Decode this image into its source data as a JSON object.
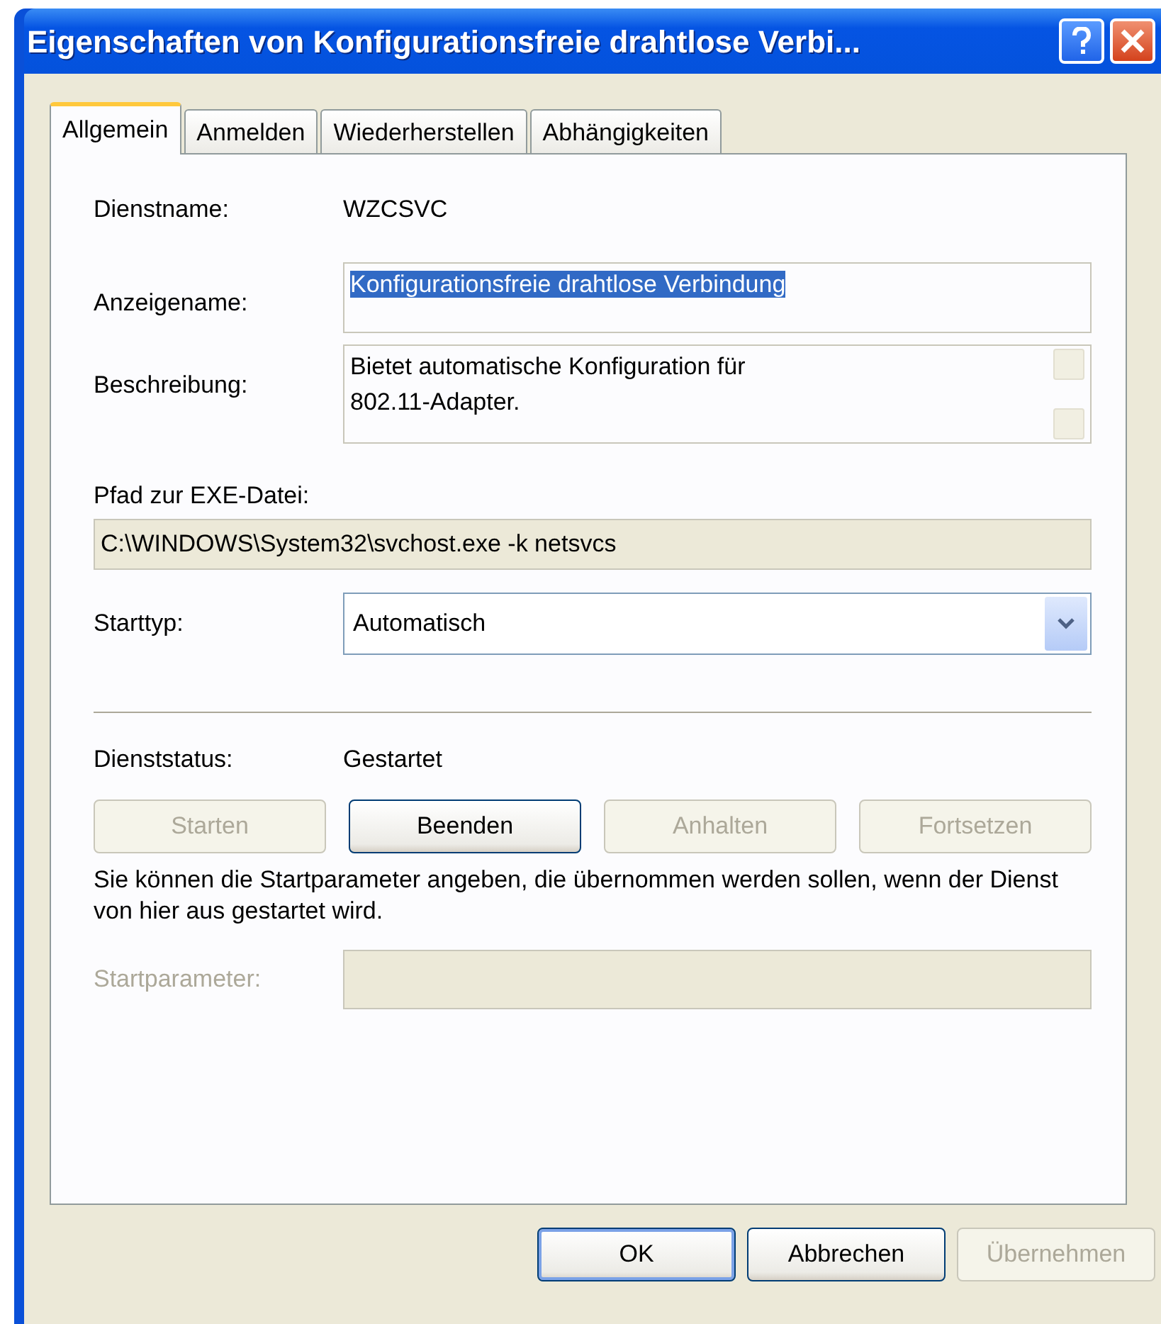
{
  "window": {
    "title": "Eigenschaften von Konfigurationsfreie drahtlose Verbi..."
  },
  "tabs": [
    {
      "label": "Allgemein",
      "selected": true
    },
    {
      "label": "Anmelden",
      "selected": false
    },
    {
      "label": "Wiederherstellen",
      "selected": false
    },
    {
      "label": "Abhängigkeiten",
      "selected": false
    }
  ],
  "service_name": {
    "label": "Dienstname:",
    "value": "WZCSVC"
  },
  "display_name": {
    "label": "Anzeigename:",
    "value": "Konfigurationsfreie drahtlose Verbindung",
    "selected": true
  },
  "description": {
    "label": "Beschreibung:",
    "lines": [
      "Bietet automatische Konfiguration für",
      "802.11-Adapter."
    ]
  },
  "exe_path": {
    "label": "Pfad zur EXE-Datei:",
    "value": "C:\\WINDOWS\\System32\\svchost.exe -k netsvcs"
  },
  "startup_type": {
    "label": "Starttyp:",
    "value": "Automatisch"
  },
  "service_status": {
    "label": "Dienststatus:",
    "value": "Gestartet"
  },
  "service_buttons": [
    {
      "label": "Starten",
      "disabled": true
    },
    {
      "label": "Beenden",
      "disabled": false
    },
    {
      "label": "Anhalten",
      "disabled": true
    },
    {
      "label": "Fortsetzen",
      "disabled": true
    }
  ],
  "hint": "Sie können die Startparameter angeben, die übernommen werden sollen, wenn der Dienst von hier aus gestartet wird.",
  "start_parameters": {
    "label": "Startparameter:",
    "disabled": true
  },
  "dialog_buttons": [
    {
      "label": "OK",
      "default": true,
      "disabled": false
    },
    {
      "label": "Abbrechen",
      "default": false,
      "disabled": false
    },
    {
      "label": "Übernehmen",
      "default": false,
      "disabled": true
    }
  ]
}
